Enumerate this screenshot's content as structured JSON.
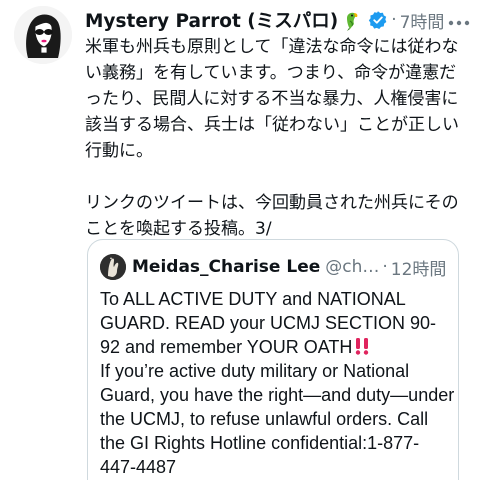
{
  "tweet": {
    "author": {
      "display_name": "Mystery Parrot (ミスパロ)",
      "avatar_icon": "woman-sunglasses-avatar",
      "name_emoji_icon": "parrot-icon",
      "verified_icon": "verified-badge-icon",
      "verified_color": "#1d9bf0"
    },
    "separator": "·",
    "time": "7時間",
    "more_icon": "more-options-icon",
    "text_paragraph_1": "米軍も州兵も原則として「違法な命令には従わない義務」を有しています。つまり、命令が違憲だったり、民間人に対する不当な暴力、人権侵害に該当する場合、兵士は「従わない」ことが正しい行動に。",
    "text_paragraph_2": "リンクのツイートは、今回動員された州兵にそのことを喚起する投稿。3/"
  },
  "quoted_tweet": {
    "display_name": "Meidas_Charise Lee",
    "handle": "@ch…",
    "separator": "·",
    "time": "12時間",
    "avatar_icon": "quoted-user-avatar",
    "text_line_1": "To ALL  ACTIVE DUTY and NATIONAL GUARD.  READ  your UCMJ SECTION 90-92 and remember YOUR OATH",
    "emphasis_icon": "double-exclamation-icon",
    "emphasis_color": "#e0245e",
    "text_line_2": "If you’re active duty military or National Guard, you have the right—and duty—under the UCMJ, to refuse unlawful orders. Call the GI Rights Hotline confidential:1-877-447-4487"
  },
  "colors": {
    "text": "#0f1419",
    "secondary_text": "#6b7780",
    "border": "#cfd9de",
    "background": "#ffffff"
  }
}
